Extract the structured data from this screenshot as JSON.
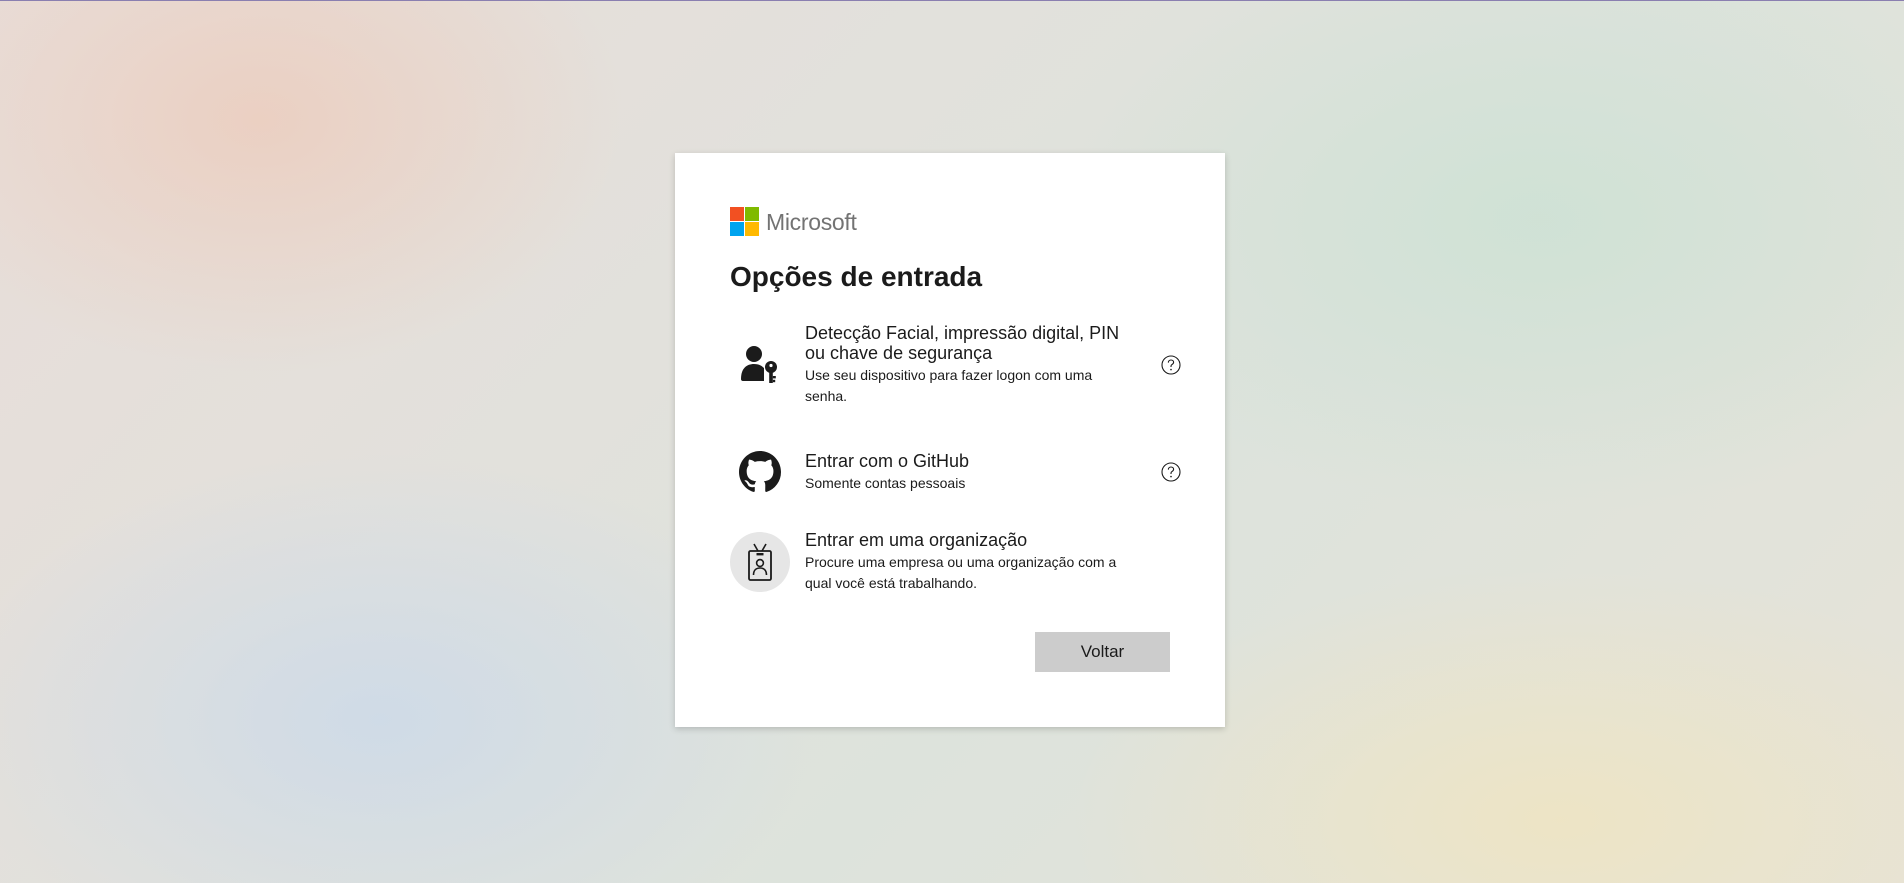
{
  "brand": {
    "name": "Microsoft",
    "logo_colors": [
      "#f25022",
      "#7fba00",
      "#00a4ef",
      "#ffb900"
    ]
  },
  "page": {
    "title": "Opções de entrada"
  },
  "options": [
    {
      "title": "Detecção Facial, impressão digital, PIN ou chave de segurança",
      "description": "Use seu dispositivo para fazer logon com uma senha.",
      "icon": "person-key-icon",
      "has_help": true
    },
    {
      "title": "Entrar com o GitHub",
      "description": "Somente contas pessoais",
      "icon": "github-icon",
      "has_help": true
    },
    {
      "title": "Entrar em uma organização",
      "description": "Procure uma empresa ou uma organização com a qual você está trabalhando.",
      "icon": "id-badge-icon",
      "has_help": false
    }
  ],
  "footer": {
    "back_label": "Voltar"
  },
  "colors": {
    "card_bg": "#ffffff",
    "button_bg": "#cccccc",
    "text": "#1b1b1b",
    "brand_text": "#737373"
  }
}
